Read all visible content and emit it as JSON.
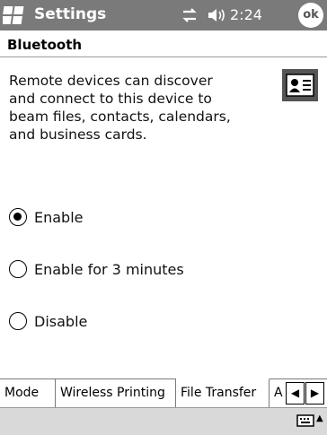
{
  "titlebar": {
    "title": "Settings",
    "time": "2:24",
    "ok_label": "ok"
  },
  "section": {
    "title": "Bluetooth"
  },
  "content": {
    "description_lines": [
      "Remote devices can discover",
      "and connect to this device to",
      "beam files, contacts, calendars,",
      "and business cards."
    ],
    "options": [
      {
        "label": "Enable",
        "checked": true
      },
      {
        "label": "Enable for 3 minutes",
        "checked": false
      },
      {
        "label": "Disable",
        "checked": false
      }
    ]
  },
  "tabs": [
    {
      "label": "Mode",
      "active": false
    },
    {
      "label": "Wireless Printing",
      "active": false
    },
    {
      "label": "File Transfer",
      "active": true
    },
    {
      "label": "A",
      "active": false
    }
  ],
  "icons": {
    "start": "windows-start-icon",
    "connectivity": "connectivity-icon",
    "volume": "speaker-volume-icon",
    "device": "contact-card-icon",
    "keyboard": "keyboard-icon",
    "tab_left": "arrow-left-icon",
    "tab_right": "arrow-right-icon"
  },
  "colors": {
    "titlebar": "#7a7a7a",
    "menubar": "#d9d9d9"
  }
}
